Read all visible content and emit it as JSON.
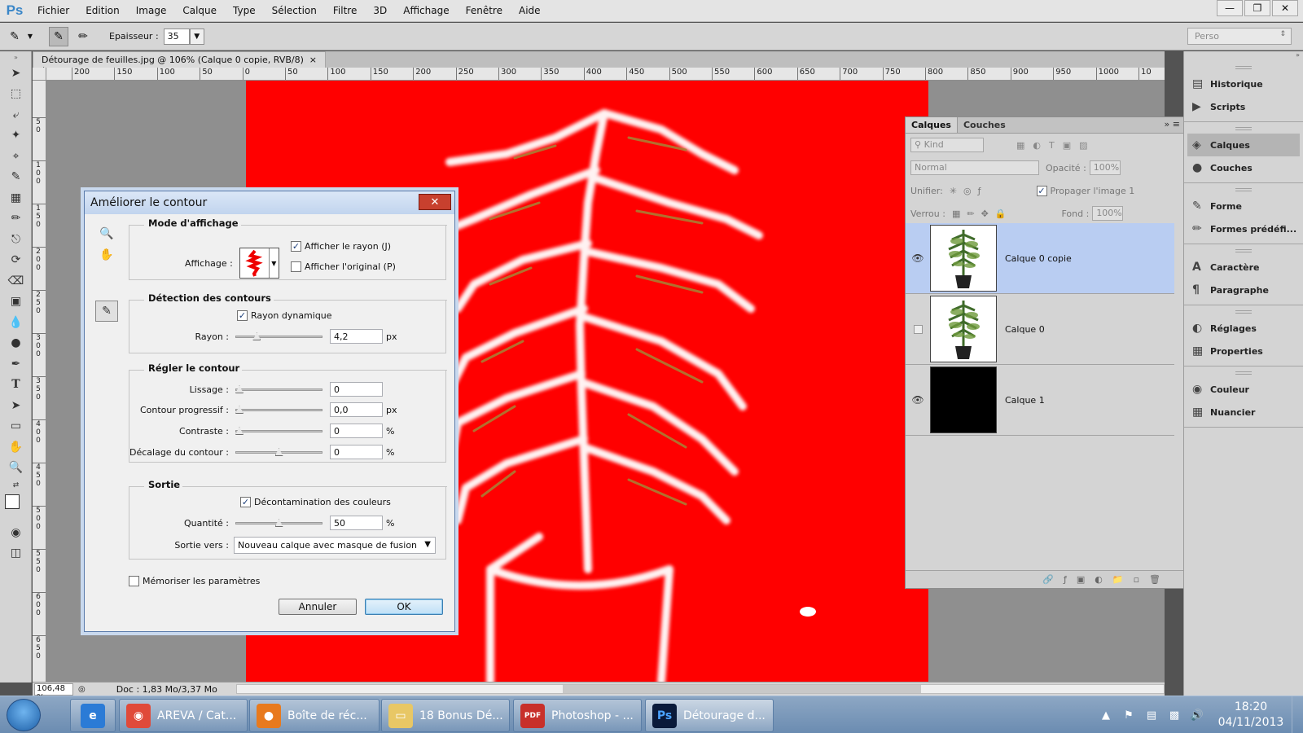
{
  "app": {
    "logo": "Ps",
    "menu": [
      "Fichier",
      "Edition",
      "Image",
      "Calque",
      "Type",
      "Sélection",
      "Filtre",
      "3D",
      "Affichage",
      "Fenêtre",
      "Aide"
    ],
    "window_controls": [
      "minimize-icon",
      "restore-icon",
      "close-icon"
    ]
  },
  "options_bar": {
    "epaisseur_label": "Epaisseur :",
    "epaisseur_value": "35",
    "workspace": "Perso"
  },
  "document": {
    "tab_title": "Détourage de feuilles.jpg @ 106% (Calque 0 copie, RVB/8) *",
    "tab_close": "×",
    "ruler_h": [
      "200",
      "150",
      "100",
      "50",
      "0",
      "50",
      "100",
      "150",
      "200",
      "250",
      "300",
      "350",
      "400",
      "450",
      "500",
      "550",
      "600",
      "650",
      "700",
      "750",
      "800",
      "850",
      "900",
      "950",
      "1000",
      "10"
    ],
    "ruler_v": [
      "50",
      "100",
      "150",
      "200",
      "250",
      "300",
      "350",
      "400",
      "450",
      "500",
      "550",
      "600",
      "650"
    ],
    "canvas_color": "#ff0000"
  },
  "status": {
    "zoom": "106,48 %",
    "doc_size": "Doc : 1,83 Mo/3,37 Mo"
  },
  "dock": {
    "groups": [
      [
        {
          "label": "Historique",
          "icon": "history-icon"
        },
        {
          "label": "Scripts",
          "icon": "play-icon"
        }
      ],
      [
        {
          "label": "Calques",
          "icon": "layers-icon",
          "selected": true
        },
        {
          "label": "Couches",
          "icon": "channels-icon"
        }
      ],
      [
        {
          "label": "Forme",
          "icon": "brush-icon"
        },
        {
          "label": "Formes prédéfi...",
          "icon": "brush-presets-icon"
        }
      ],
      [
        {
          "label": "Caractère",
          "icon": "character-icon"
        },
        {
          "label": "Paragraphe",
          "icon": "paragraph-icon"
        }
      ],
      [
        {
          "label": "Réglages",
          "icon": "adjustments-icon"
        },
        {
          "label": "Properties",
          "icon": "properties-icon"
        }
      ],
      [
        {
          "label": "Couleur",
          "icon": "color-icon"
        },
        {
          "label": "Nuancier",
          "icon": "swatches-icon"
        }
      ]
    ]
  },
  "layers_panel": {
    "tabs": [
      "Calques",
      "Couches"
    ],
    "kind_label": "Kind",
    "blend_mode": "Normal",
    "opacity_label": "Opacité :",
    "opacity_value": "100%",
    "unify_label": "Unifier:",
    "propagate_label": "Propager l'image 1",
    "lock_label": "Verrou :",
    "fill_label": "Fond :",
    "fill_value": "100%",
    "layers": [
      {
        "name": "Calque 0 copie",
        "visible": true,
        "selected": true,
        "thumb": "plant"
      },
      {
        "name": "Calque 0",
        "visible": false,
        "selected": false,
        "thumb": "plant"
      },
      {
        "name": "Calque 1",
        "visible": true,
        "selected": false,
        "thumb": "black"
      }
    ]
  },
  "dialog": {
    "title": "Améliorer le contour",
    "sections": {
      "view": {
        "title": "Mode d'affichage",
        "affichage_label": "Affichage :",
        "show_radius": "Afficher le rayon (J)",
        "show_original": "Afficher l'original (P)",
        "show_radius_checked": true,
        "show_original_checked": false
      },
      "edge": {
        "title": "Détection des contours",
        "smart_radius": "Rayon dynamique",
        "smart_radius_checked": true,
        "radius_label": "Rayon :",
        "radius_value": "4,2",
        "radius_unit": "px",
        "radius_slider": 0.22
      },
      "adjust": {
        "title": "Régler le contour",
        "smooth_label": "Lissage :",
        "smooth_value": "0",
        "feather_label": "Contour progressif :",
        "feather_value": "0,0",
        "feather_unit": "px",
        "contrast_label": "Contraste :",
        "contrast_value": "0",
        "contrast_unit": "%",
        "shift_label": "Décalage du contour :",
        "shift_value": "0",
        "shift_unit": "%"
      },
      "output": {
        "title": "Sortie",
        "decontaminate": "Décontamination des couleurs",
        "decontaminate_checked": true,
        "amount_label": "Quantité :",
        "amount_value": "50",
        "amount_unit": "%",
        "output_label": "Sortie vers :",
        "output_value": "Nouveau calque avec masque de fusion"
      }
    },
    "remember": "Mémoriser les paramètres",
    "remember_checked": false,
    "cancel": "Annuler",
    "ok": "OK"
  },
  "taskbar": {
    "items": [
      {
        "label": "",
        "icon": "ie-icon",
        "color": "#2b7bd6"
      },
      {
        "label": "AREVA / Cat...",
        "icon": "chrome-icon",
        "color": "#e04a3a"
      },
      {
        "label": "Boîte de réc...",
        "icon": "firefox-icon",
        "color": "#e87a1e"
      },
      {
        "label": "18 Bonus Dé...",
        "icon": "folder-icon",
        "color": "#e8c765"
      },
      {
        "label": "Photoshop - ...",
        "icon": "pdf-icon",
        "color": "#c8302a"
      },
      {
        "label": "Détourage d...",
        "icon": "photoshop-icon",
        "color": "#0a1a3a",
        "active": true
      }
    ],
    "clock_time": "18:20",
    "clock_date": "04/11/2013"
  }
}
